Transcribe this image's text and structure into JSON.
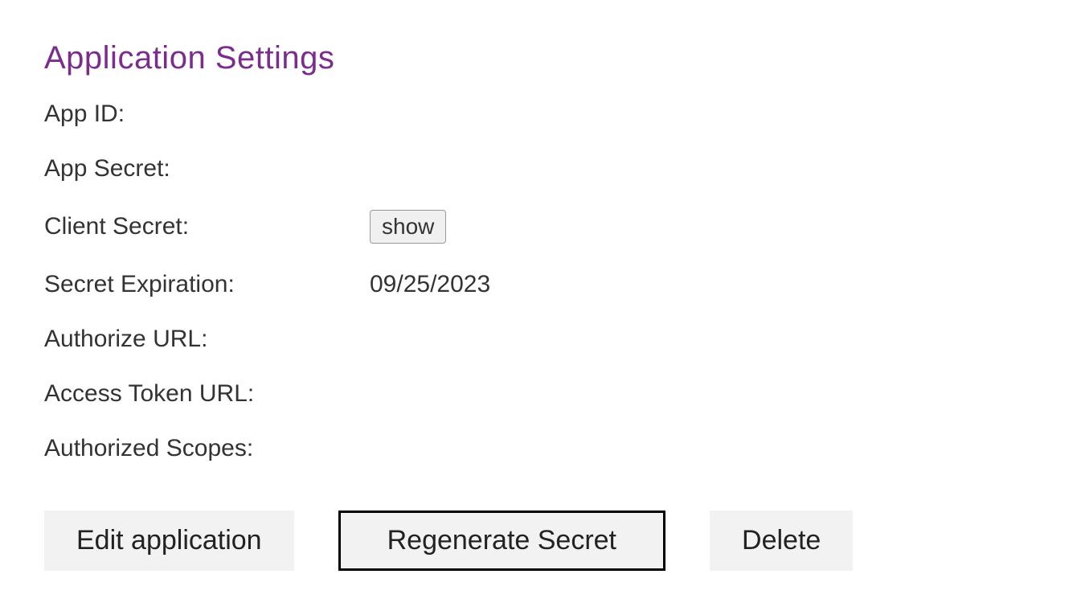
{
  "header": {
    "title": "Application Settings"
  },
  "fields": {
    "app_id": {
      "label": "App ID:",
      "value": ""
    },
    "app_secret": {
      "label": "App Secret:",
      "value": ""
    },
    "client_secret": {
      "label": "Client Secret:",
      "show_label": "show"
    },
    "secret_expiration": {
      "label": "Secret Expiration:",
      "value": "09/25/2023"
    },
    "authorize_url": {
      "label": "Authorize URL:",
      "value": ""
    },
    "access_token_url": {
      "label": "Access Token URL:",
      "value": ""
    },
    "authorized_scopes": {
      "label": "Authorized Scopes:",
      "value": ""
    }
  },
  "actions": {
    "edit": "Edit application",
    "regenerate": "Regenerate Secret",
    "delete": "Delete"
  }
}
